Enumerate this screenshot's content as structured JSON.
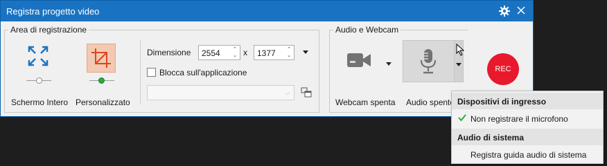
{
  "window": {
    "title": "Registra progetto video"
  },
  "area": {
    "group_label": "Area di registrazione",
    "fullscreen_label": "Schermo Intero",
    "custom_label": "Personalizzato",
    "dimension_label": "Dimensione",
    "width": "2554",
    "times": "x",
    "height": "1377",
    "lock_label": "Blocca sull'applicazione",
    "lock_checked": false,
    "app_select_value": ""
  },
  "audio": {
    "group_label": "Audio e Webcam",
    "webcam_label": "Webcam spenta",
    "audio_label": "Audio spento",
    "rec_label": "REC"
  },
  "menu": {
    "section1": "Dispositivi di ingresso",
    "item1": "Non registrare il microfono",
    "item1_checked": true,
    "section2": "Audio di sistema",
    "item2": "Registra guida audio di sistema"
  },
  "colors": {
    "titlebar": "#1a73c2",
    "rec": "#e8192c",
    "accent_icon": "#1a73c2",
    "custom_icon_bg": "#f3c9b2",
    "custom_icon_fg": "#d9471f",
    "check": "#2eaa3a"
  },
  "icons": {
    "gear": "gear-icon",
    "close": "close-icon",
    "fullscreen": "fullscreen-expand-icon",
    "custom": "crop-icon",
    "webcam": "video-camera-icon",
    "mic": "microphone-icon",
    "link": "select-window-icon"
  }
}
